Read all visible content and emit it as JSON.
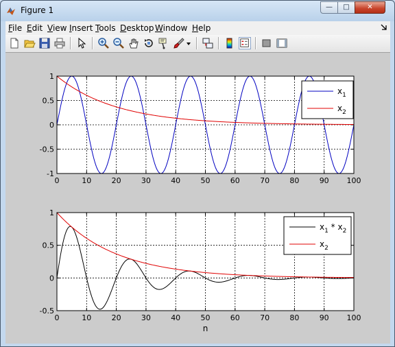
{
  "window": {
    "title": "Figure 1",
    "min_label": "—",
    "max_label": "□",
    "close_label": "✕"
  },
  "menu": [
    {
      "u": "F",
      "rest": "ile"
    },
    {
      "u": "E",
      "rest": "dit"
    },
    {
      "u": "V",
      "rest": "iew"
    },
    {
      "u": "I",
      "rest": "nsert"
    },
    {
      "u": "T",
      "rest": "ools"
    },
    {
      "u": "D",
      "rest": "esktop"
    },
    {
      "u": "W",
      "rest": "indow"
    },
    {
      "u": "H",
      "rest": "elp"
    }
  ],
  "dock_icon": "dock-arrow-icon",
  "toolbar": [
    "new-figure-icon",
    "open-file-icon",
    "save-icon",
    "print-icon",
    "edit-plot-arrow-icon",
    "zoom-in-icon",
    "zoom-out-icon",
    "pan-hand-icon",
    "rotate-3d-icon",
    "data-cursor-icon",
    "brush-icon",
    "dropdown-arrow-icon",
    "link-plot-icon",
    "colorbar-icon",
    "legend-icon",
    "hide-plot-tools-icon",
    "show-plot-tools-icon"
  ],
  "chart_data": [
    {
      "type": "line",
      "xlabel": "",
      "ylabel": "",
      "xlim": [
        0,
        100
      ],
      "ylim": [
        -1,
        1
      ],
      "xticks": [
        "0",
        "10",
        "20",
        "30",
        "40",
        "50",
        "60",
        "70",
        "80",
        "90",
        "100"
      ],
      "yticks": [
        "-1",
        "-0.5",
        "0",
        "0.5",
        "1"
      ],
      "grid": true,
      "legend_position": "top-right",
      "series": [
        {
          "name": "x_1",
          "name_main": "x",
          "name_sub": "1",
          "color": "#0000c0",
          "formula": "sin(2*pi*0.05*n)",
          "x_start": 0,
          "x_end": 100
        },
        {
          "name": "x_2",
          "name_main": "x",
          "name_sub": "2",
          "color": "#e00000",
          "formula": "exp(-0.05*n)",
          "x_start": 0,
          "x_end": 100
        }
      ]
    },
    {
      "type": "line",
      "xlabel": "n",
      "ylabel": "",
      "xlim": [
        0,
        100
      ],
      "ylim": [
        -0.5,
        1
      ],
      "xticks": [
        "0",
        "10",
        "20",
        "30",
        "40",
        "50",
        "60",
        "70",
        "80",
        "90",
        "100"
      ],
      "yticks": [
        "-0.5",
        "0",
        "0.5",
        "1"
      ],
      "grid": true,
      "legend_position": "top-right",
      "series": [
        {
          "name": "x_1 * x_2",
          "name_main": "x",
          "name_sub": "1",
          "name_mid": " * x",
          "name_sub2": "2",
          "color": "#000000",
          "formula": "sin(2*pi*0.05*n)*exp(-0.05*n)",
          "x_start": 0,
          "x_end": 100
        },
        {
          "name": "x_2",
          "name_main": "x",
          "name_sub": "2",
          "color": "#e00000",
          "formula": "exp(-0.05*n)",
          "x_start": 0,
          "x_end": 100
        }
      ]
    }
  ]
}
